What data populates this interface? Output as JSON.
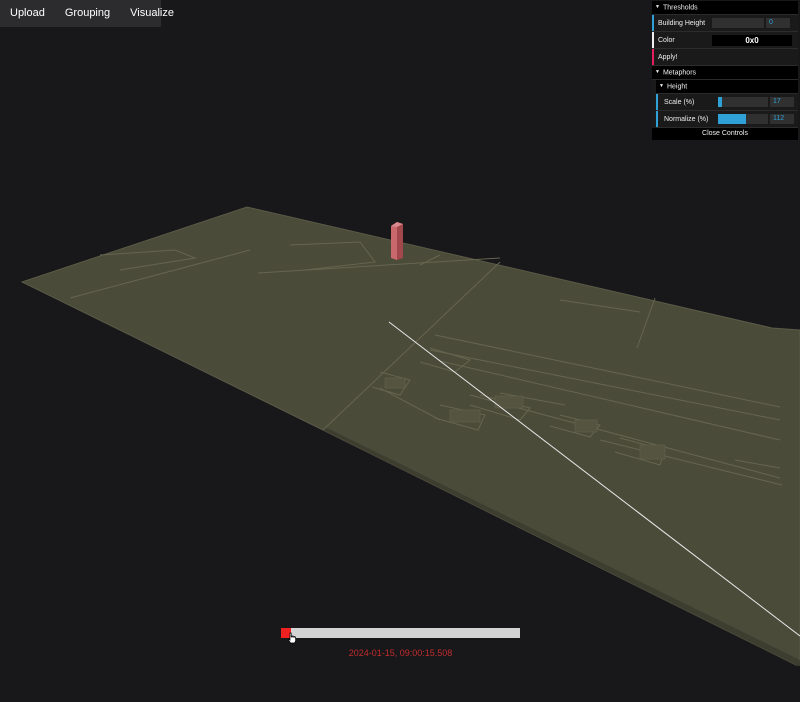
{
  "menu": {
    "items": [
      {
        "label": "Upload"
      },
      {
        "label": "Grouping"
      },
      {
        "label": "Visualize"
      }
    ]
  },
  "gui": {
    "thresholds": {
      "title": "Thresholds",
      "building_height_label": "Building Height",
      "building_height_value": "0",
      "color_label": "Color",
      "color_value": "0x0",
      "apply_label": "Apply!"
    },
    "metaphors": {
      "title": "Metaphors",
      "height": {
        "title": "Height",
        "scale_label": "Scale (%)",
        "scale_value": "17",
        "scale_fraction": 0.08,
        "normalize_label": "Normalize (%)",
        "normalize_value": "112",
        "normalize_fraction": 0.56
      }
    },
    "close_label": "Close Controls"
  },
  "timeline": {
    "timestamp": "2024-01-15, 09:00:15.508",
    "position_fraction": 0.0
  },
  "colors": {
    "background": "#18171a",
    "ground": "#4b4b3a",
    "building": "#c9696e",
    "accent_blue": "#2fa1d6",
    "apply_red": "#e61d5f",
    "timeline_handle": "#ef2020",
    "timestamp_text": "#c22d2d"
  },
  "icons": {
    "folder_open": "triangle-down-icon",
    "cursor": "hand-pointer-icon"
  }
}
